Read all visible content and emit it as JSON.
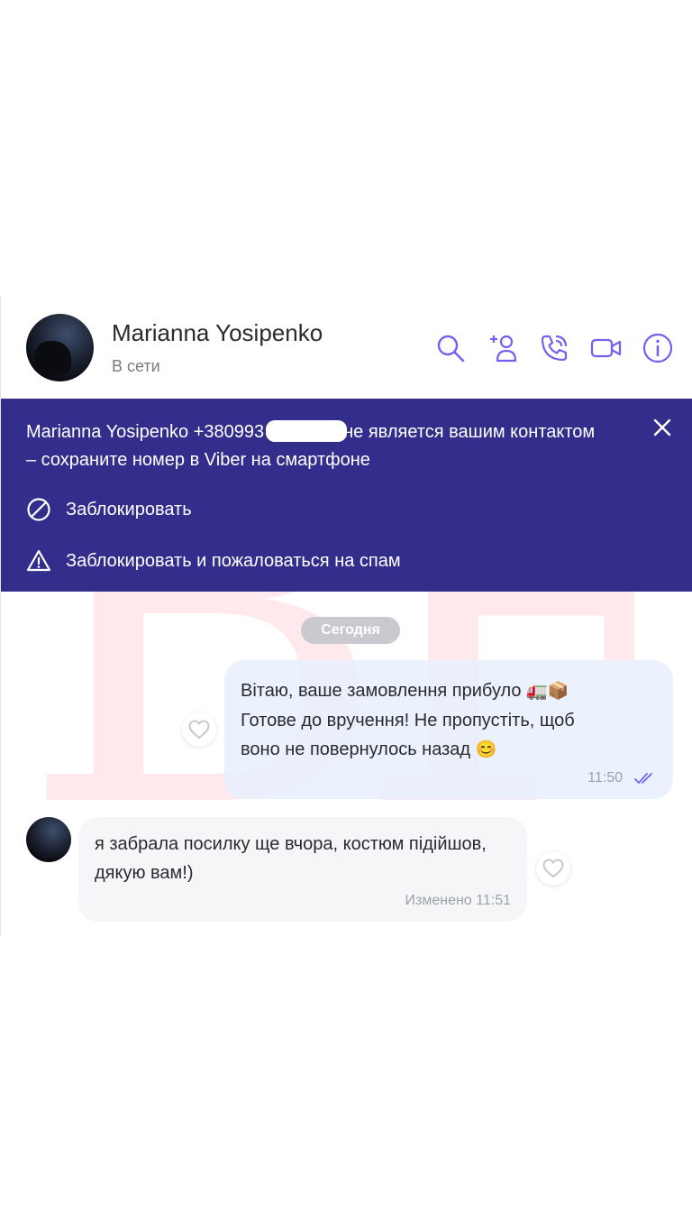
{
  "contact": {
    "name": "Marianna Yosipenko",
    "status": "В сети"
  },
  "header_icons": [
    "search-icon",
    "add-contact-icon",
    "call-icon",
    "video-call-icon",
    "info-icon"
  ],
  "banner": {
    "text_part1": "Marianna Yosipenko +380993",
    "text_part2": "не является вашим контактом – сохраните номер в Viber на смартфоне",
    "block_label": "Заблокировать",
    "block_spam_label": "Заблокировать и пожаловаться на спам"
  },
  "date_separator": "Сегодня",
  "messages": {
    "outgoing": {
      "line1": "Вітаю, ваше замовлення прибуло",
      "emoji1": "🚛📦",
      "line2": "Готове до вручення! Не пропустіть, щоб",
      "line3": "воно не повернулось назад",
      "emoji2": "😊",
      "time": "11:50"
    },
    "incoming": {
      "text": "я забрала посилку ще вчора, костюм підійшов, дякую вам!)",
      "time": "Изменено 11:51"
    }
  },
  "watermark": "BF",
  "colors": {
    "accent": "#7360f2",
    "banner_bg": "#332e8c",
    "outgoing_bubble": "#e7f0fd",
    "incoming_bubble": "#f5f5f7",
    "date_pill": "#c9c9cf"
  }
}
